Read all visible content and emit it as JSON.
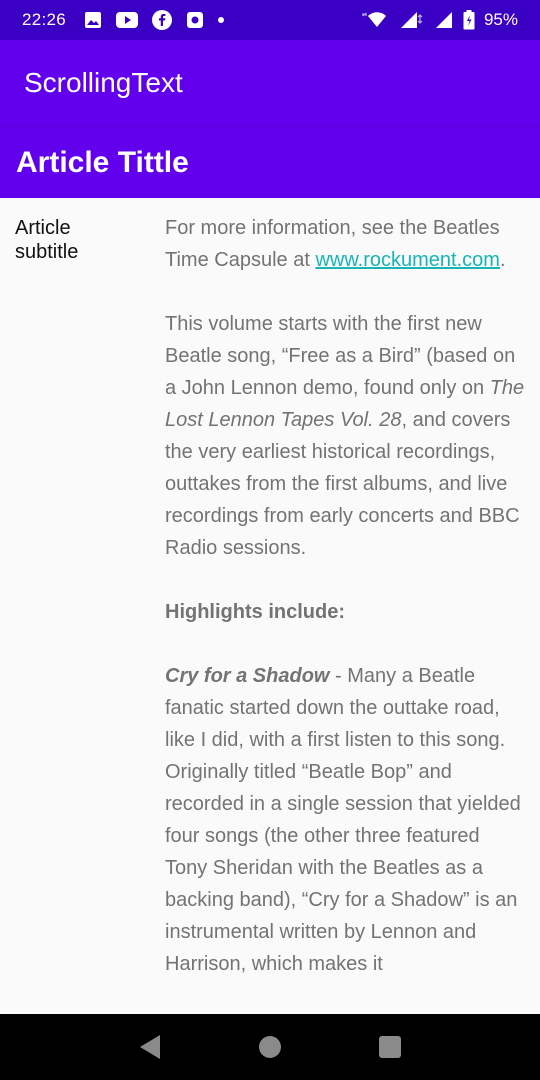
{
  "status_bar": {
    "time": "22:26",
    "battery": "95%",
    "notification_icons": [
      "gallery-icon",
      "youtube-icon",
      "facebook-icon",
      "app-icon"
    ]
  },
  "app_bar": {
    "title": "ScrollingText"
  },
  "article": {
    "title": "Article Tittle",
    "subtitle": "Article subtitle",
    "p1_before": "For more information, see the Beatles Time Capsule at ",
    "p1_link": "www.rockument.com",
    "p1_after": ".",
    "p2_before": " This volume starts with the first new Beatle song, “Free as a Bird” (based on a John Lennon demo, found only on ",
    "p2_italic": "The Lost Lennon Tapes Vol. 28",
    "p2_after": ", and covers the very earliest historical recordings, outtakes from the first albums, and live recordings from early concerts and BBC Radio sessions.",
    "highlights_heading": " Highlights include:",
    "p3_title": " Cry for a Shadow",
    "p3_text": " - Many a Beatle fanatic started down the outtake road, like I did, with a first listen to this song. Originally titled “Beatle Bop” and recorded in a single session that yielded four songs (the other three featured Tony Sheridan with the Beatles as a backing band), “Cry for a Shadow” is an instrumental written by Lennon and Harrison, which makes it"
  },
  "colors": {
    "status_bar": "#3a00c4",
    "primary": "#6200ee",
    "link": "#17b5b5",
    "body_text": "#737373"
  }
}
